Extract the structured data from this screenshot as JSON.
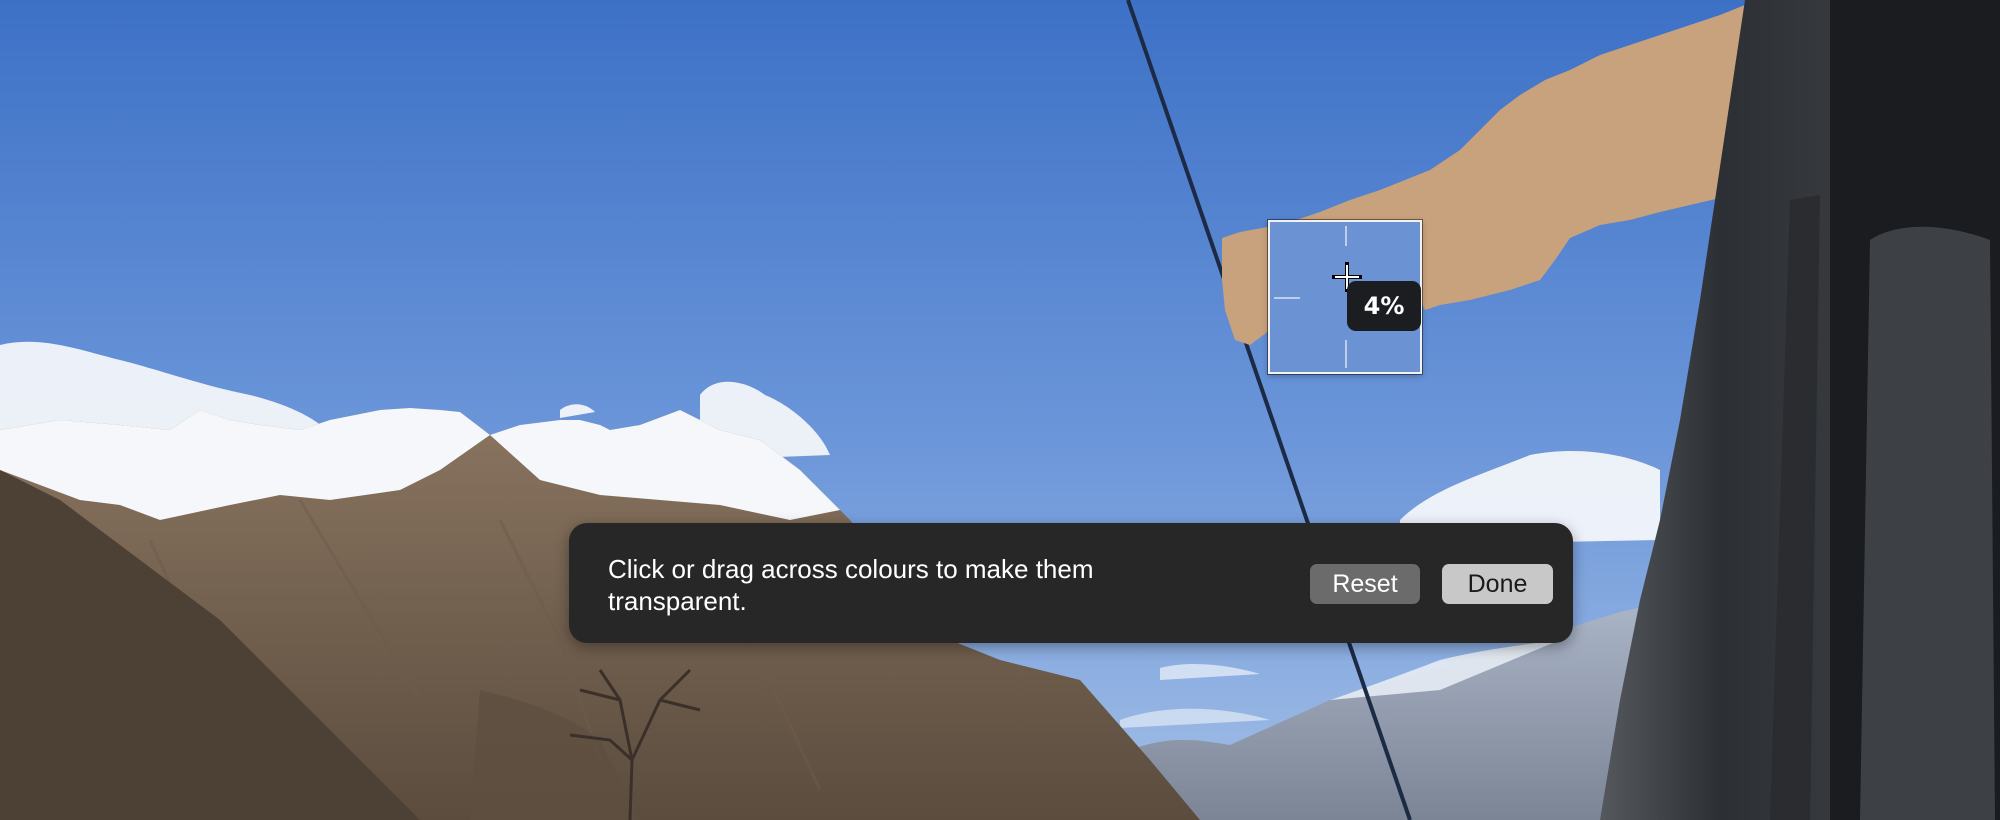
{
  "instant_alpha": {
    "instruction": "Click or drag across colours to make them transparent.",
    "reset_label": "Reset",
    "done_label": "Done",
    "tolerance": "4%"
  },
  "colors": {
    "sky_top": "#3f73c7",
    "sky_bottom": "#82a8e0",
    "selection_tint": "#c8a27c",
    "bar_background": "#272727",
    "reset_button": "#6b6b6b",
    "done_button": "#c8c8c8"
  },
  "icons": {
    "cursor": "crosshair-icon"
  }
}
